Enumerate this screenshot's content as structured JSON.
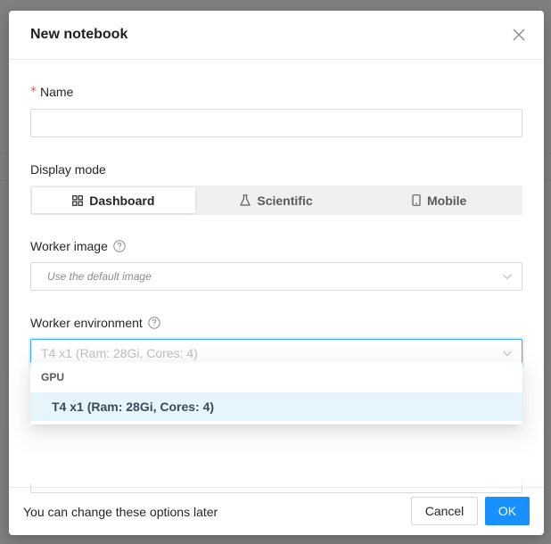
{
  "modal": {
    "title": "New notebook",
    "close_icon": "close-icon"
  },
  "form": {
    "name": {
      "label": "Name",
      "required_mark": "*",
      "value": ""
    },
    "display_mode": {
      "label": "Display mode",
      "options": [
        {
          "label": "Dashboard",
          "icon": "dashboard-icon",
          "selected": true
        },
        {
          "label": "Scientific",
          "icon": "flask-icon",
          "selected": false
        },
        {
          "label": "Mobile",
          "icon": "mobile-icon",
          "selected": false
        }
      ]
    },
    "worker_image": {
      "label": "Worker image",
      "help_icon": "question-circle-icon",
      "placeholder": "Use the default image"
    },
    "worker_environment": {
      "label": "Worker environment",
      "help_icon": "question-circle-icon",
      "value": "T4 x1 (Ram: 28Gi, Cores: 4)",
      "dropdown": {
        "group": "GPU",
        "options": [
          "T4 x1 (Ram: 28Gi, Cores: 4)"
        ]
      }
    }
  },
  "footer": {
    "note": "You can change these options later",
    "cancel_label": "Cancel",
    "ok_label": "OK"
  },
  "colors": {
    "primary": "#1890ff",
    "required": "#ff4d4f",
    "option_highlight": "#e6f4fc"
  }
}
